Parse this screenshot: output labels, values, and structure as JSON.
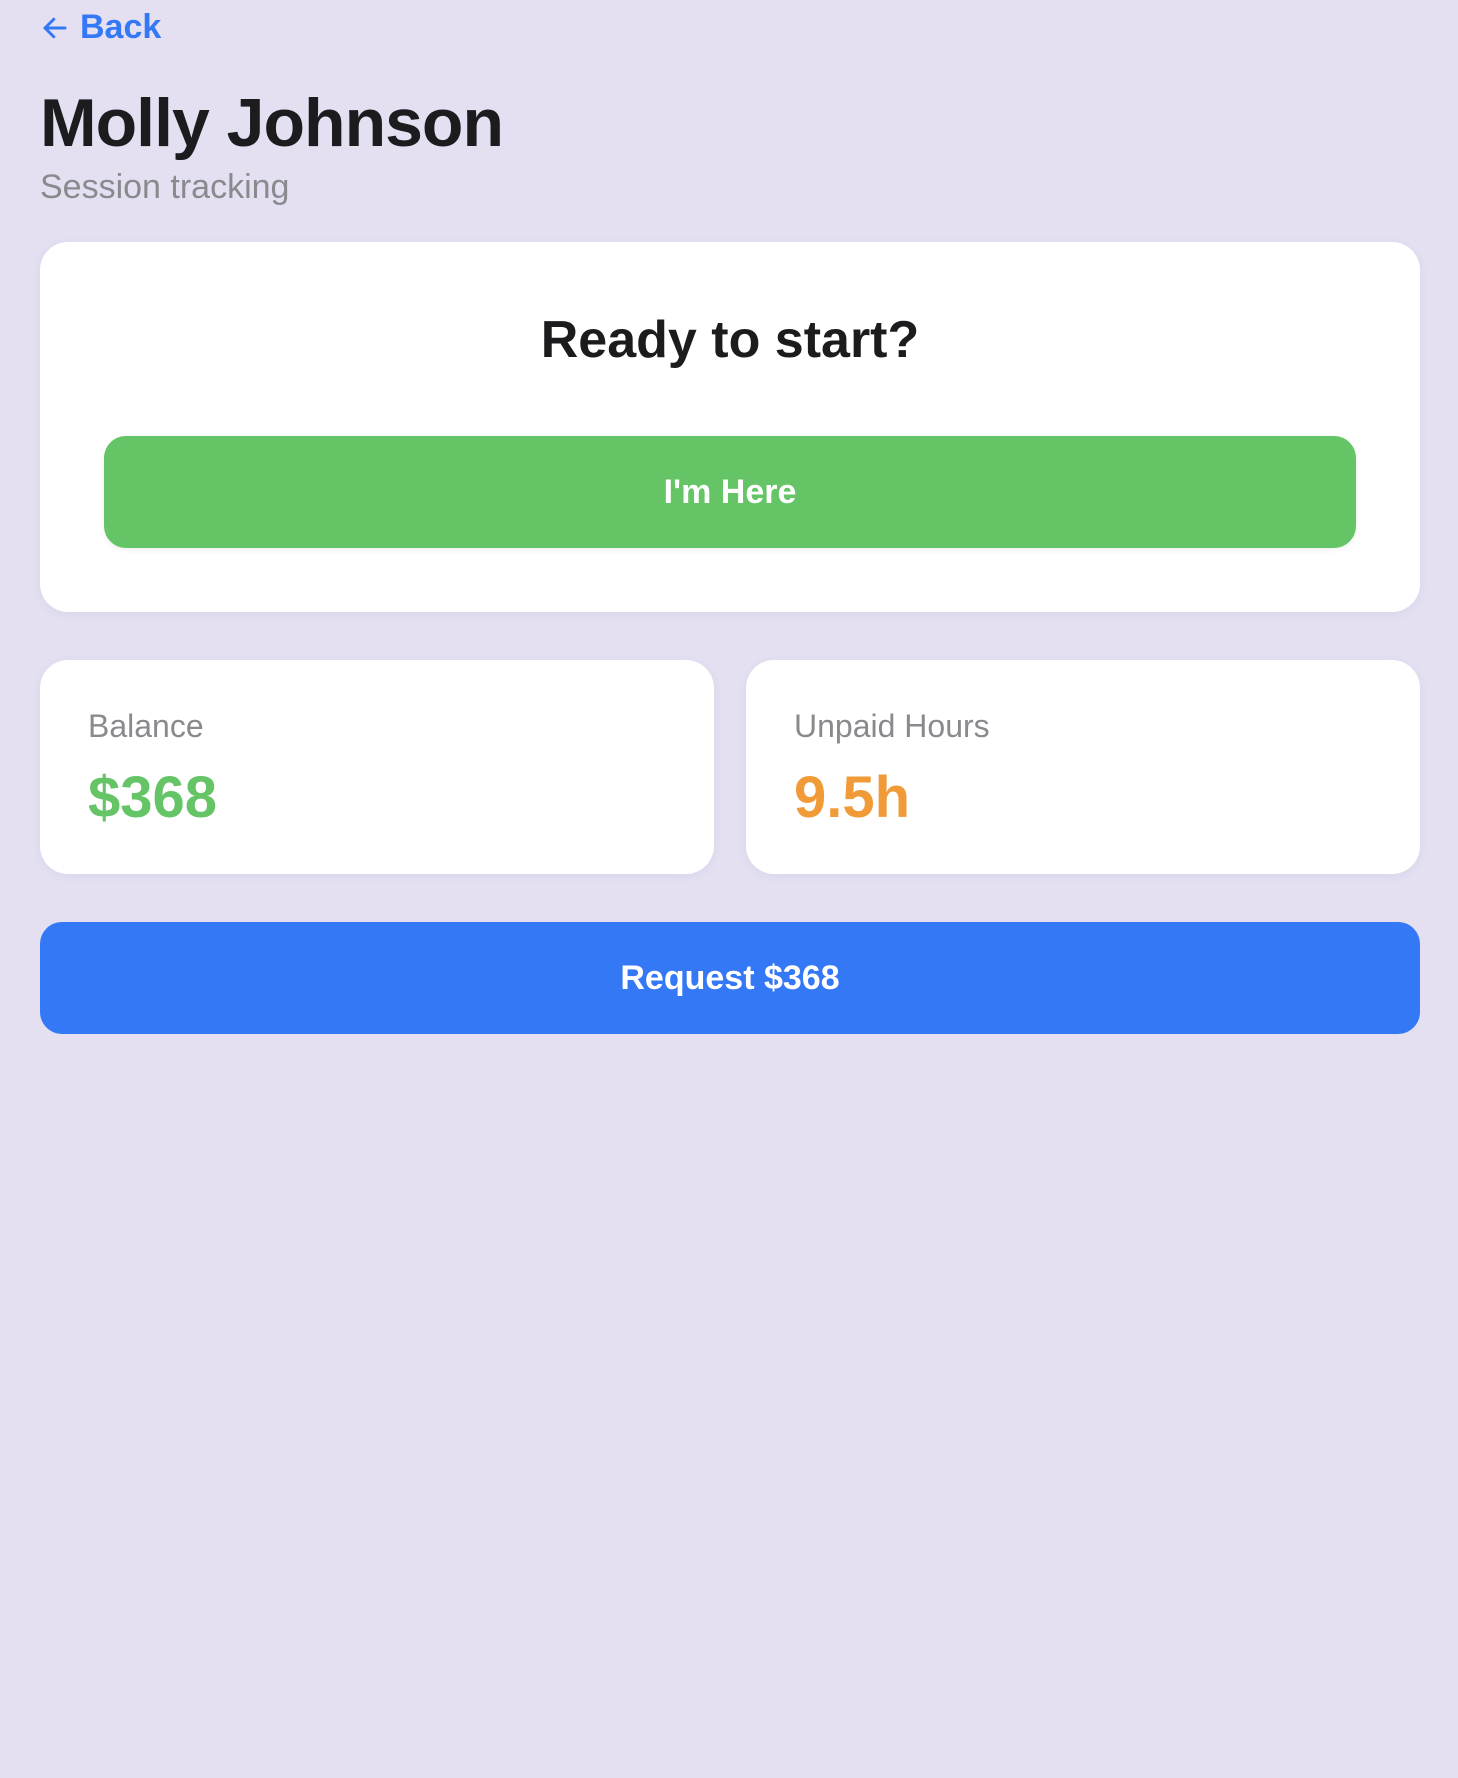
{
  "nav": {
    "back_label": "Back",
    "back_icon": "arrow-left-icon"
  },
  "header": {
    "title": "Molly Johnson",
    "subtitle": "Session tracking"
  },
  "start_card": {
    "heading": "Ready to start?",
    "checkin_label": "I'm Here"
  },
  "stats": {
    "balance": {
      "label": "Balance",
      "value": "$368"
    },
    "unpaid_hours": {
      "label": "Unpaid Hours",
      "value": "9.5h"
    }
  },
  "actions": {
    "request_label": "Request $368"
  },
  "colors": {
    "background": "#e4e0f2",
    "accent_blue": "#3478f6",
    "success_green": "#65c466",
    "warning_orange": "#f19a38",
    "text_primary": "#1c1c1e",
    "text_secondary": "#8a8a8e"
  }
}
